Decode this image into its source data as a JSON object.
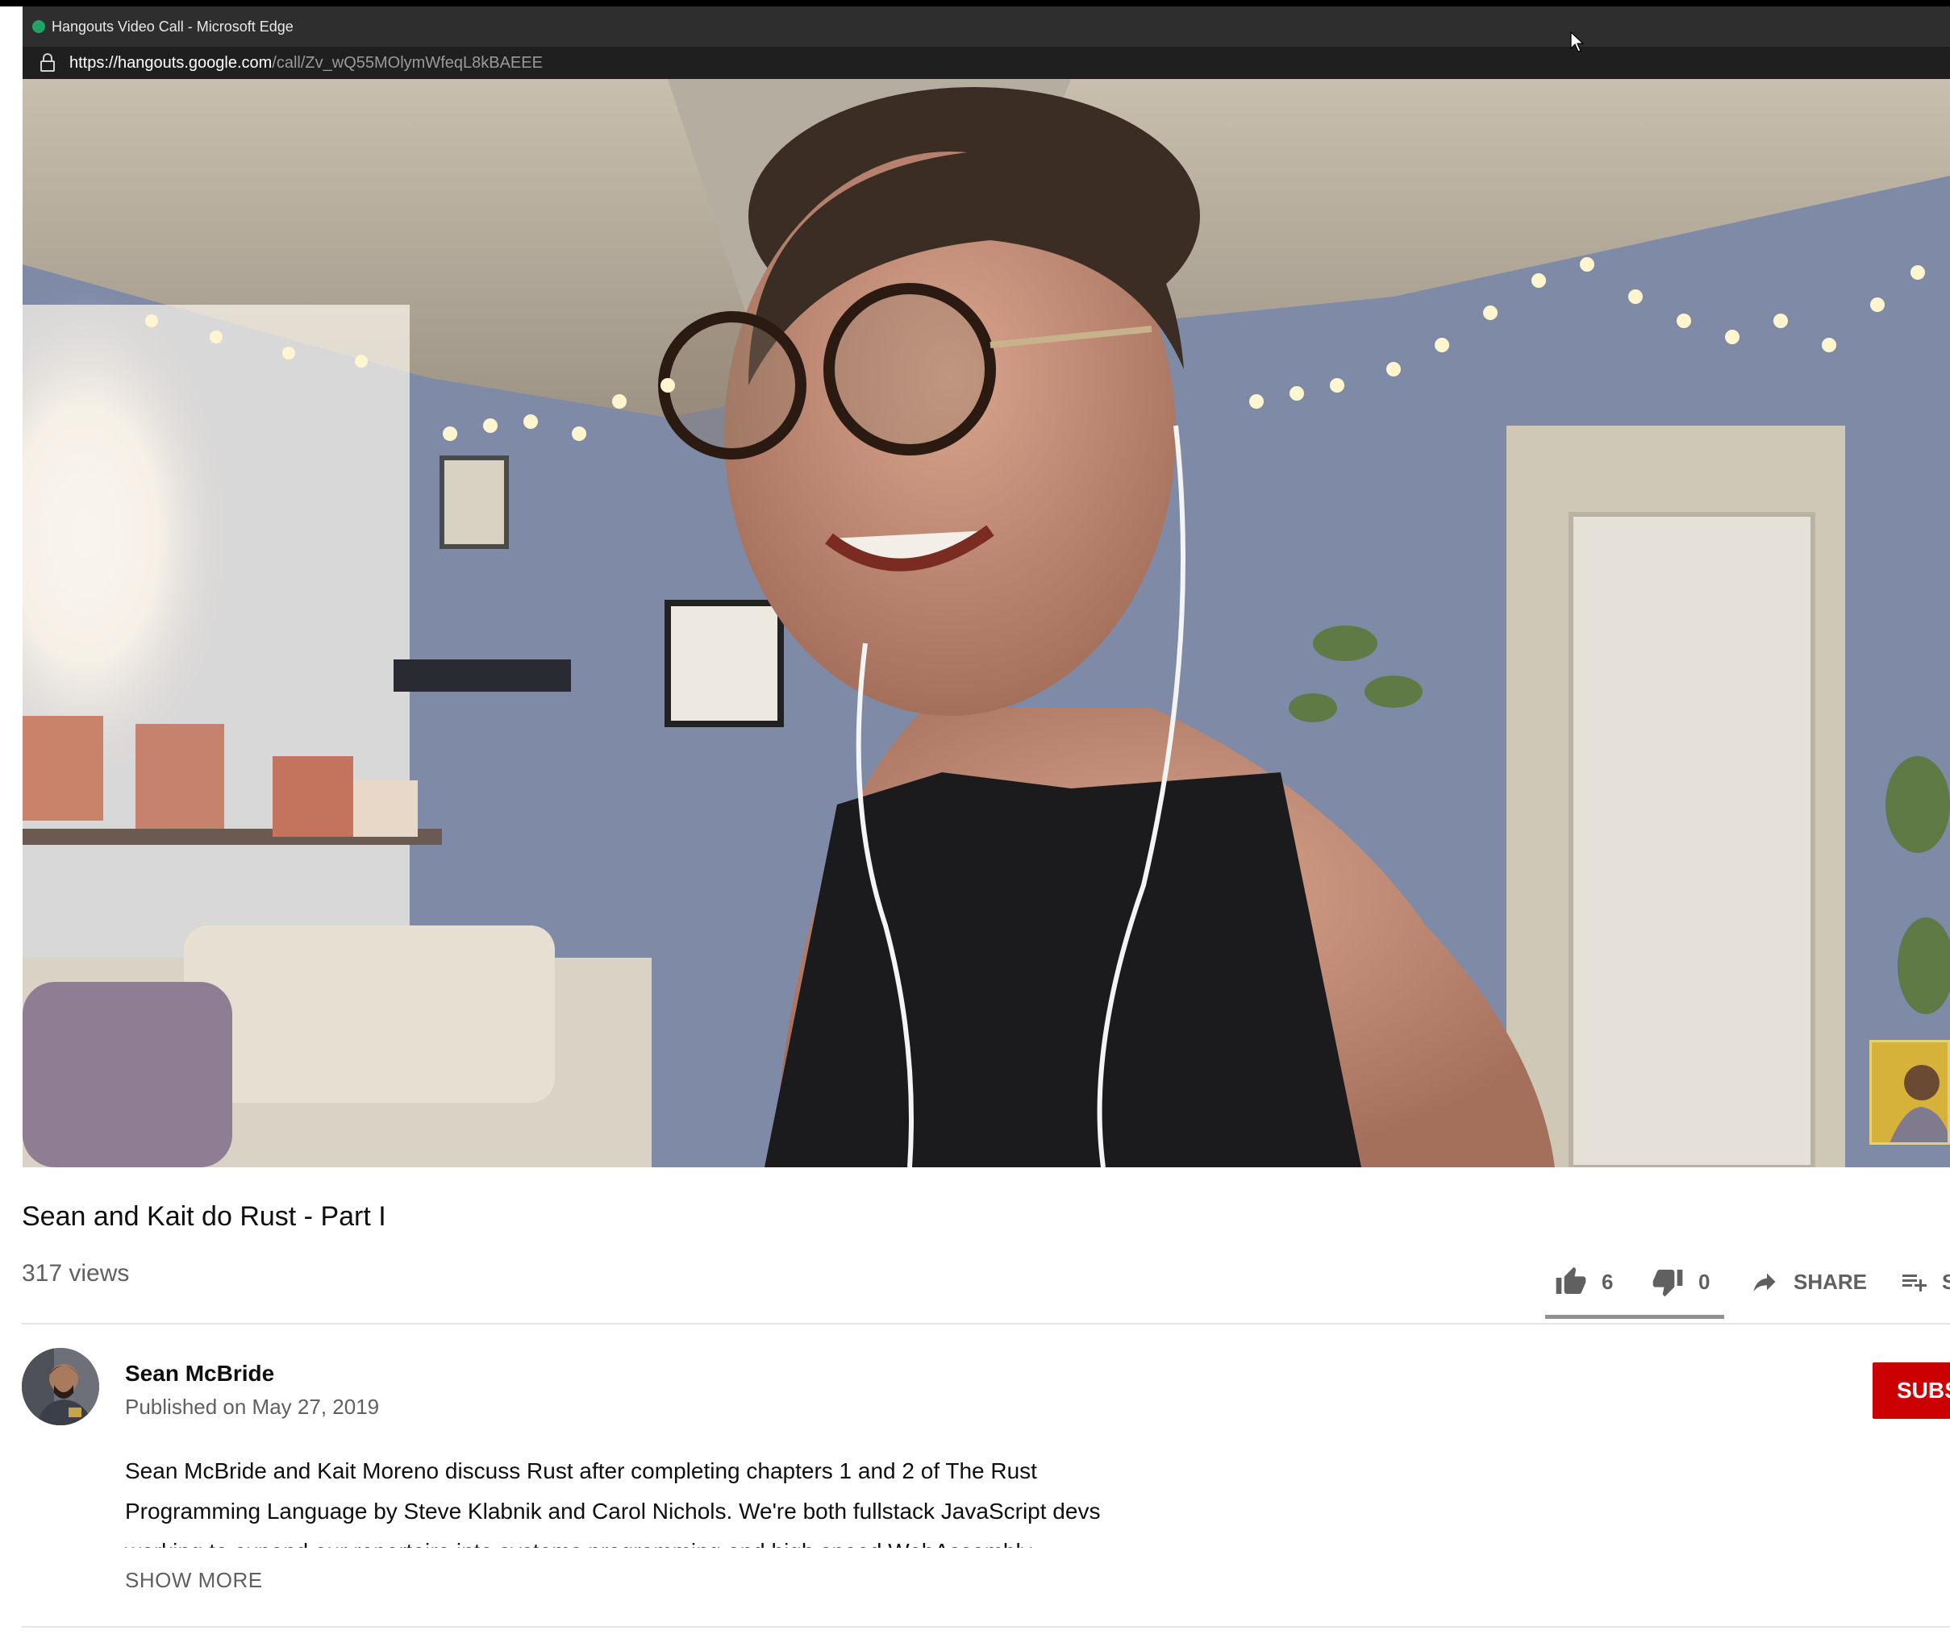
{
  "browser": {
    "window_title": "Hangouts Video Call - Microsoft Edge",
    "url_host": "https://hangouts.google.com",
    "url_path": "/call/Zv_wQ55MOlymWfeqL8kBAEEE"
  },
  "video": {
    "title": "Sean and Kait do Rust - Part I",
    "views": "317 views",
    "likes": "6",
    "dislikes": "0",
    "share_label": "SHARE",
    "save_label": "S",
    "like_ratio": 1.0
  },
  "channel": {
    "name": "Sean McBride",
    "published": "Published on May 27, 2019",
    "subscribe_label": "SUBS"
  },
  "description": {
    "line1": "Sean McBride and Kait Moreno discuss Rust after completing chapters 1 and 2 of The Rust",
    "line2": "Programming Language by Steve Klabnik and Carol Nichols. We're both fullstack JavaScript devs",
    "line3": "working to expand our repertoire into systems programming and high speed WebAssembly",
    "show_more": "SHOW MORE"
  },
  "colors": {
    "subscribe": "#cc0000",
    "secondary_text": "#606060",
    "divider": "#e5e5e5"
  }
}
